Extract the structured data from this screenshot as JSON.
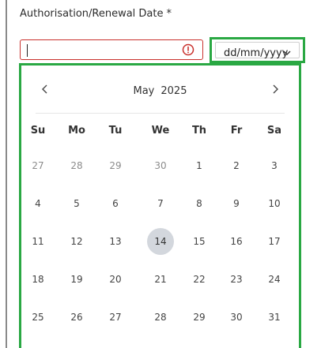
{
  "field": {
    "label": "Authorisation/Renewal Date",
    "required_marker": "*",
    "value": "",
    "error_color": "#c9302c"
  },
  "format_select": {
    "value": "dd/mm/yyyy",
    "icon": "chevron-down-icon"
  },
  "calendar": {
    "month": "May",
    "year": "2025",
    "prev_icon": "chevron-left-icon",
    "next_icon": "chevron-right-icon",
    "weekdays": [
      "Su",
      "Mo",
      "Tu",
      "We",
      "Th",
      "Fr",
      "Sa"
    ],
    "weeks": [
      [
        "27",
        "28",
        "29",
        "30",
        "1",
        "2",
        "3"
      ],
      [
        "4",
        "5",
        "6",
        "7",
        "8",
        "9",
        "10"
      ],
      [
        "11",
        "12",
        "13",
        "14",
        "15",
        "16",
        "17"
      ],
      [
        "18",
        "19",
        "20",
        "21",
        "22",
        "23",
        "24"
      ],
      [
        "25",
        "26",
        "27",
        "28",
        "29",
        "30",
        "31"
      ]
    ],
    "outside_month_days": [
      "27",
      "28",
      "29",
      "30"
    ],
    "highlighted_day": "14",
    "highlight_color": "#d3d7dd",
    "focus_outline_color": "#2aa843"
  }
}
